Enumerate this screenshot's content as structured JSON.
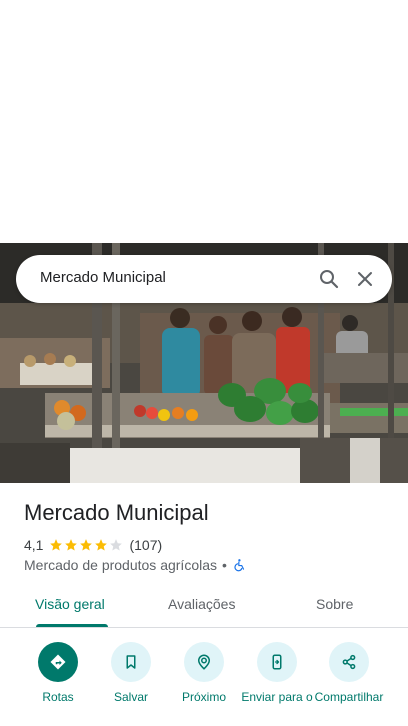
{
  "search": {
    "query": "Mercado Municipal"
  },
  "place": {
    "title": "Mercado Municipal",
    "rating": "4,1",
    "rating_value": 4.1,
    "rating_max": 5,
    "review_count": "(107)",
    "category": "Mercado de produtos agrícolas",
    "separator": "•"
  },
  "tabs": [
    {
      "label": "Visão geral",
      "active": true
    },
    {
      "label": "Avaliações",
      "active": false
    },
    {
      "label": "Sobre",
      "active": false
    }
  ],
  "actions": [
    {
      "label": "Rotas",
      "icon": "directions-icon"
    },
    {
      "label": "Salvar",
      "icon": "bookmark-icon"
    },
    {
      "label": "Próximo",
      "icon": "nearby-icon"
    },
    {
      "label": "Enviar para o",
      "icon": "send-to-phone-icon"
    },
    {
      "label": "Compartilhar",
      "icon": "share-icon"
    }
  ],
  "colors": {
    "accent": "#00796b",
    "action_bg": "#e0f4f8",
    "star": "#fbbc04"
  }
}
